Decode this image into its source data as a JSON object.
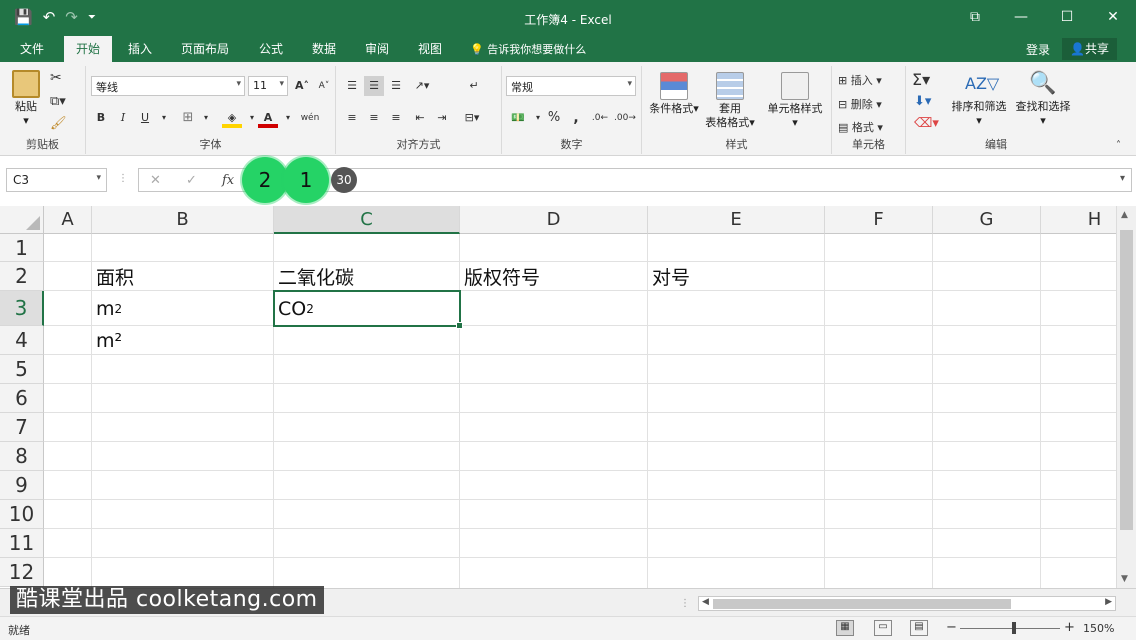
{
  "titlebar": {
    "title": "工作簿4 - Excel",
    "save_icon": "💾",
    "undo_icon": "↶",
    "redo_icon": "↷",
    "customize_icon": "⏷",
    "ribbon_display_icon": "⧉",
    "minimize_icon": "—",
    "maximize_icon": "☐",
    "close_icon": "✕"
  },
  "tabs": [
    "文件",
    "开始",
    "插入",
    "页面布局",
    "公式",
    "数据",
    "审阅",
    "视图"
  ],
  "active_tab": "开始",
  "tell_me": "告诉我你想要做什么",
  "account": {
    "login": "登录",
    "share": "共享"
  },
  "ribbon": {
    "clipboard": {
      "label": "剪贴板",
      "paste": "粘贴"
    },
    "font": {
      "label": "字体",
      "name": "等线",
      "size": "11",
      "bold": "B",
      "italic": "I",
      "underline": "U",
      "grow": "A˄",
      "shrink": "A˅",
      "wen": "wén"
    },
    "alignment": {
      "label": "对齐方式"
    },
    "number": {
      "label": "数字",
      "format": "常规",
      "percent": "%",
      "comma": ","
    },
    "styles": {
      "label": "样式",
      "conditional": "条件格式",
      "table1": "套用",
      "table2": "表格格式",
      "cellstyle": "单元格样式"
    },
    "cells": {
      "label": "单元格",
      "insert": "插入",
      "delete": "删除",
      "format": "格式"
    },
    "editing": {
      "label": "编辑",
      "sort": "排序和筛选",
      "find": "查找和选择"
    }
  },
  "formula_bar": {
    "name_box": "C3",
    "cancel": "✕",
    "enter": "✓",
    "fx": "fx",
    "bubble_a": "2",
    "bubble_b": "1",
    "bubble_c": "30"
  },
  "columns": [
    "A",
    "B",
    "C",
    "D",
    "E",
    "F",
    "G",
    "H"
  ],
  "active_column": "C",
  "rows": [
    "1",
    "2",
    "3",
    "4",
    "5",
    "6",
    "7",
    "8",
    "9",
    "10",
    "11",
    "12"
  ],
  "active_row": "3",
  "cells": {
    "B2": "面积",
    "C2": "二氧化碳",
    "D2": "版权符号",
    "E2": "对号",
    "B3_base": "m",
    "B3_sup": "2",
    "C3_base": "CO",
    "C3_sub": "2",
    "B4": "m²"
  },
  "watermark": "酷课堂出品 coolketang.com",
  "status": {
    "ready": "就绪",
    "zoom": "150%",
    "zoom_minus": "−",
    "zoom_plus": "+"
  }
}
